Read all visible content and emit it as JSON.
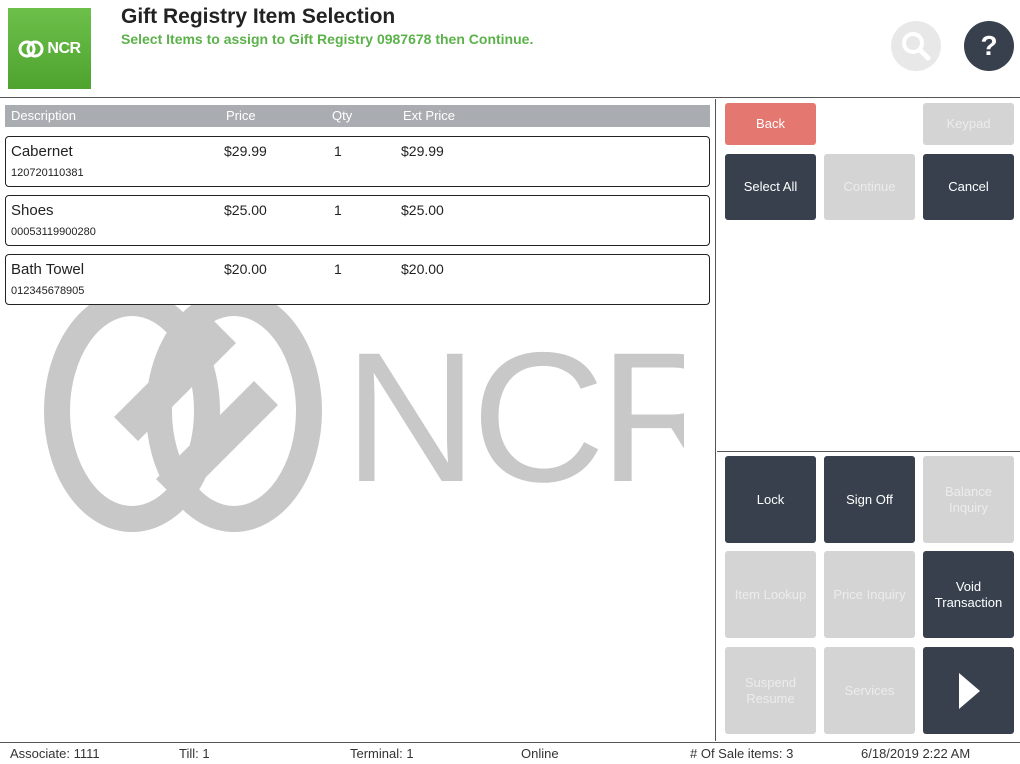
{
  "header": {
    "logo_text": "NCR",
    "title": "Gift Registry Item Selection",
    "subtitle": "Select Items to assign to Gift Registry 0987678 then Continue.",
    "help_label": "?"
  },
  "watermark": {
    "text": "NCR"
  },
  "table": {
    "columns": [
      "Description",
      "Price",
      "Qty",
      "Ext Price"
    ],
    "rows": [
      {
        "description": "Cabernet",
        "code": "120720110381",
        "price": "$29.99",
        "qty": "1",
        "ext_price": "$29.99"
      },
      {
        "description": "Shoes",
        "code": "00053119900280",
        "price": "$25.00",
        "qty": "1",
        "ext_price": "$25.00"
      },
      {
        "description": "Bath Towel",
        "code": "012345678905",
        "price": "$20.00",
        "qty": "1",
        "ext_price": "$20.00"
      }
    ]
  },
  "actions": {
    "back": "Back",
    "keypad": "Keypad",
    "select_all": "Select All",
    "continue": "Continue",
    "cancel": "Cancel"
  },
  "functions": {
    "lock": "Lock",
    "sign_off": "Sign Off",
    "balance_inquiry": "Balance Inquiry",
    "item_lookup": "Item Lookup",
    "price_inquiry": "Price Inquiry",
    "void_transaction": "Void Transaction",
    "suspend_resume": "Suspend Resume",
    "services": "Services"
  },
  "status": {
    "associate": "Associate: 1111",
    "till": "Till: 1",
    "terminal": "Terminal: 1",
    "online": "Online",
    "sale_items": "# Of Sale items: 3",
    "datetime": "6/18/2019 2:22 AM"
  },
  "colors": {
    "brand_green": "#5cb24a",
    "dark_button": "#37404c",
    "disabled_button": "#d4d4d4",
    "back_button": "#e47871",
    "table_header": "#a9adb2"
  },
  "icons": {
    "search": "search-icon",
    "help": "help-icon",
    "next": "chevron-right-icon",
    "logo": "ncr-logo-icon"
  }
}
